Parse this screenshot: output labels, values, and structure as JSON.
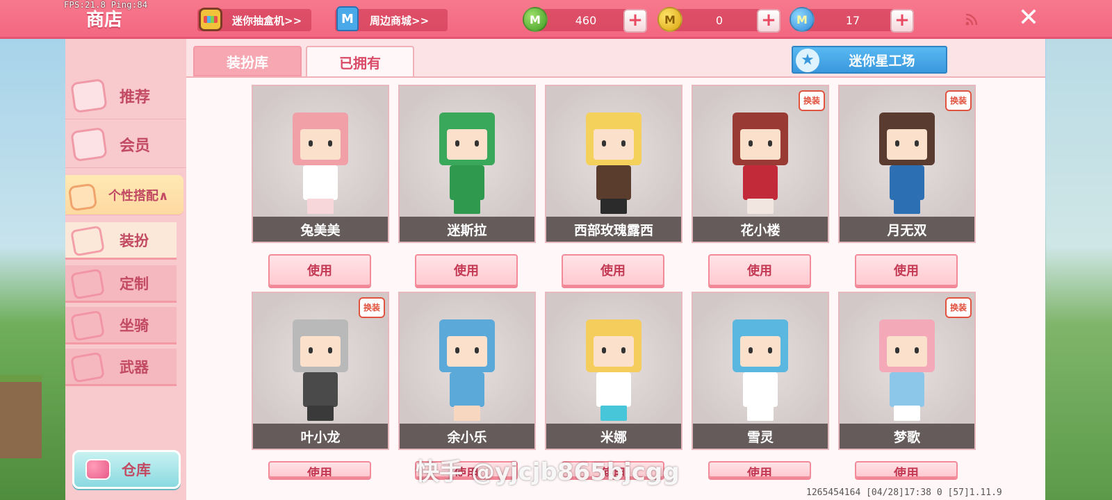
{
  "debug": {
    "fps_text": "FPS:21.8  Ping:84"
  },
  "header": {
    "title": "商店",
    "gacha_label": "迷你抽盒机>>",
    "mall_label": "周边商城>>",
    "currencies": [
      {
        "icon": "green-mini-bean-icon",
        "value": "460"
      },
      {
        "icon": "gold-mini-coin-icon",
        "value": "0"
      },
      {
        "icon": "blue-mini-coin-icon",
        "value": "17"
      }
    ],
    "plus_label": "+",
    "close_label": "✕"
  },
  "sidebar": {
    "items": [
      {
        "label": "推荐",
        "icon": "thumbs-up-icon"
      },
      {
        "label": "会员",
        "icon": "vip-card-icon"
      },
      {
        "label": "个性搭配∧",
        "icon": "fashion-icon"
      }
    ],
    "sub_items": [
      {
        "label": "装扮",
        "icon": "shirt-icon"
      },
      {
        "label": "定制",
        "icon": "brush-icon"
      },
      {
        "label": "坐骑",
        "icon": "mount-icon"
      },
      {
        "label": "武器",
        "icon": "gun-icon"
      }
    ],
    "warehouse_label": "仓库"
  },
  "tabs": {
    "library": "装扮库",
    "owned": "已拥有"
  },
  "workshop_label": "迷你星工场",
  "workshop_icon": "star-icon",
  "badge_label": "换装",
  "use_label": "使用",
  "cards": [
    {
      "name": "兔美美",
      "badge": false,
      "hair": "#f2a0a8",
      "outfit": "#ffffff",
      "legs": "#f8d7da"
    },
    {
      "name": "迷斯拉",
      "badge": false,
      "hair": "#3aa85a",
      "outfit": "#2f9a4e",
      "legs": "#2f9a4e"
    },
    {
      "name": "西部玫瑰露西",
      "badge": false,
      "hair": "#f3d15a",
      "outfit": "#5b3d2e",
      "legs": "#2b2b2b"
    },
    {
      "name": "花小楼",
      "badge": true,
      "hair": "#9a3a35",
      "outfit": "#c22a3a",
      "legs": "#f1e7e0"
    },
    {
      "name": "月无双",
      "badge": true,
      "hair": "#5a3b2f",
      "outfit": "#2c6fb3",
      "legs": "#2c6fb3"
    },
    {
      "name": "叶小龙",
      "badge": true,
      "hair": "#b9b9b9",
      "outfit": "#4a4a4a",
      "legs": "#3a3a3a"
    },
    {
      "name": "余小乐",
      "badge": false,
      "hair": "#5aa9d8",
      "outfit": "#5aa9d8",
      "legs": "#f7d7c0"
    },
    {
      "name": "米娜",
      "badge": false,
      "hair": "#f4cd5c",
      "outfit": "#ffffff",
      "legs": "#46c6d8"
    },
    {
      "name": "雪灵",
      "badge": false,
      "hair": "#5ab7e0",
      "outfit": "#ffffff",
      "legs": "#ffffff"
    },
    {
      "name": "梦歌",
      "badge": true,
      "hair": "#f4a9b8",
      "outfit": "#8cc6e8",
      "legs": "#ffffff"
    }
  ],
  "footer": {
    "info": "1265454164   [04/28]17:38 0   [57]1.11.9",
    "watermark": "快手 @yjcjb865bjcgg"
  }
}
